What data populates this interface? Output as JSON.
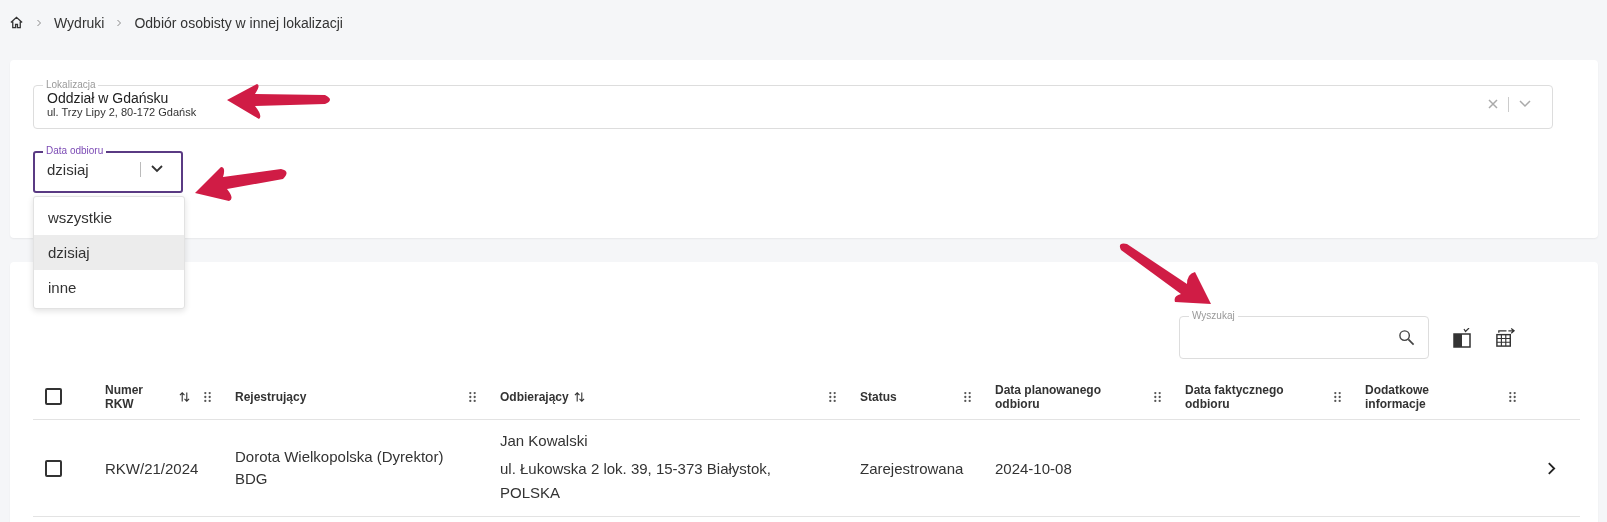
{
  "breadcrumb": {
    "items": [
      "Wydruki",
      "Odbiór osobisty w innej lokalizacji"
    ]
  },
  "filters": {
    "location": {
      "label": "Lokalizacja",
      "value": "Oddział w Gdańsku",
      "detail": "ul. Trzy Lipy 2, 80-172 Gdańsk"
    },
    "date": {
      "label": "Data odbioru",
      "value": "dzisiaj",
      "expanded": true,
      "options": [
        {
          "label": "wszystkie",
          "selected": false
        },
        {
          "label": "dzisiaj",
          "selected": true
        },
        {
          "label": "inne",
          "selected": false
        }
      ]
    }
  },
  "table": {
    "search": {
      "label": "Wyszukaj"
    },
    "all_checked": false,
    "columns": [
      {
        "label": "Numer RKW",
        "sortable": true
      },
      {
        "label": "Rejestrujący",
        "sortable": false
      },
      {
        "label": "Odbierający",
        "sortable": true
      },
      {
        "label": "Status",
        "sortable": false
      },
      {
        "label": "Data planowanego odbioru",
        "sortable": false
      },
      {
        "label": "Data faktycznego odbioru",
        "sortable": false
      },
      {
        "label": "Dodatkowe informacje",
        "sortable": false
      }
    ],
    "rows": [
      {
        "checked": false,
        "number": "RKW/21/2024",
        "registrar": "Dorota Wielkopolska (Dyrektor) BDG",
        "recipient_name": "Jan Kowalski",
        "recipient_address": "ul. Łukowska 2 lok. 39, 15-373 Białystok, POLSKA",
        "status": "Zarejestrowana",
        "planned_date": "2024-10-08"
      }
    ]
  }
}
